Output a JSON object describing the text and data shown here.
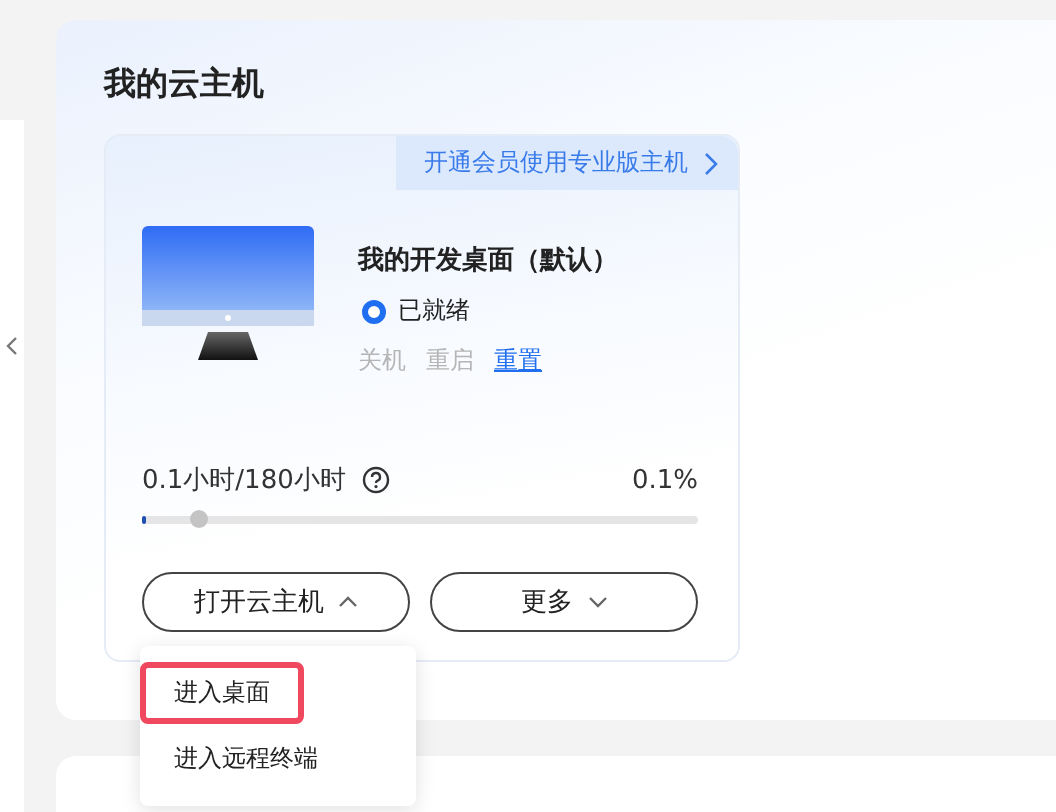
{
  "panel": {
    "title": "我的云主机"
  },
  "card": {
    "promo_link": "开通会员使用专业版主机",
    "desktop": {
      "name": "我的开发桌面（默认）",
      "status": "已就绪"
    },
    "actions": [
      {
        "label": "关机",
        "disabled": true
      },
      {
        "label": "重启",
        "disabled": true
      },
      {
        "label": "重置",
        "disabled": false
      }
    ],
    "usage": {
      "text": "0.1小时/180小时",
      "percent": "0.1%",
      "level": 0.001
    },
    "buttons": [
      {
        "label": "打开云主机",
        "expanded": true
      },
      {
        "label": "更多",
        "expanded": false
      }
    ]
  },
  "menu": {
    "items": [
      {
        "label": "进入桌面",
        "selected": true
      },
      {
        "label": "进入远程终端",
        "selected": false
      }
    ]
  }
}
